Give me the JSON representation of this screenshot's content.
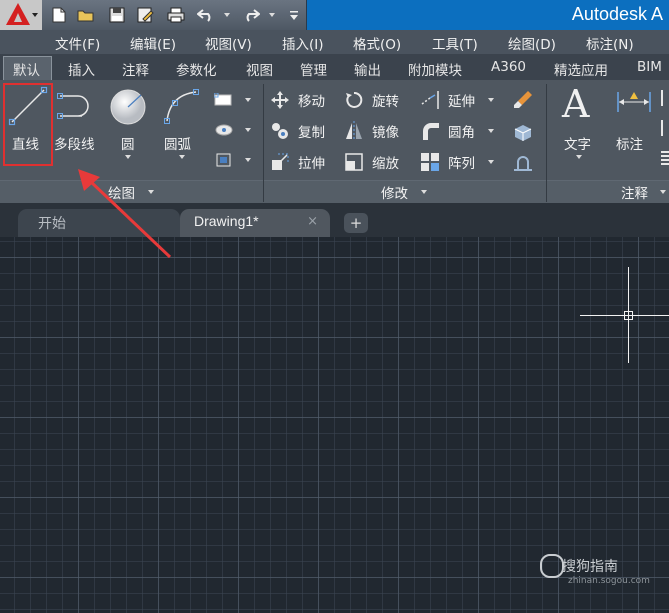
{
  "title_bar": {
    "app_title": "Autodesk A",
    "quick_access": [
      "new-icon",
      "open-icon",
      "save-icon",
      "saveas-icon",
      "print-icon",
      "undo-icon",
      "redo-icon",
      "customize-icon"
    ]
  },
  "menu": {
    "items": [
      "文件(F)",
      "编辑(E)",
      "视图(V)",
      "插入(I)",
      "格式(O)",
      "工具(T)",
      "绘图(D)",
      "标注(N)"
    ]
  },
  "ribbon_tabs": {
    "active": "默认",
    "items": [
      "默认",
      "插入",
      "注释",
      "参数化",
      "视图",
      "管理",
      "输出",
      "附加模块",
      "A360",
      "精选应用",
      "BIM"
    ]
  },
  "draw_panel": {
    "line": "直线",
    "polyline": "多段线",
    "circle": "圆",
    "arc": "圆弧",
    "footer": "绘图"
  },
  "modify_panel": {
    "move": "移动",
    "rotate": "旋转",
    "extend": "延伸",
    "copy": "复制",
    "mirror": "镜像",
    "fillet": "圆角",
    "stretch": "拉伸",
    "scale": "缩放",
    "array": "阵列",
    "footer": "修改"
  },
  "annotation_panel": {
    "text_icon": "A",
    "text": "文字",
    "dimension": "标注",
    "footer": "注释"
  },
  "doc_tabs": {
    "start": "开始",
    "drawing": "Drawing1*",
    "close": "×",
    "add": "+"
  },
  "watermark": {
    "logo": "搜狗指南",
    "url": "zhinan.sogou.com"
  },
  "colors": {
    "highlight_box": "#e03030",
    "arrow": "#e83a3a",
    "canvas": "#212830",
    "accent": "#0c6fbf"
  }
}
